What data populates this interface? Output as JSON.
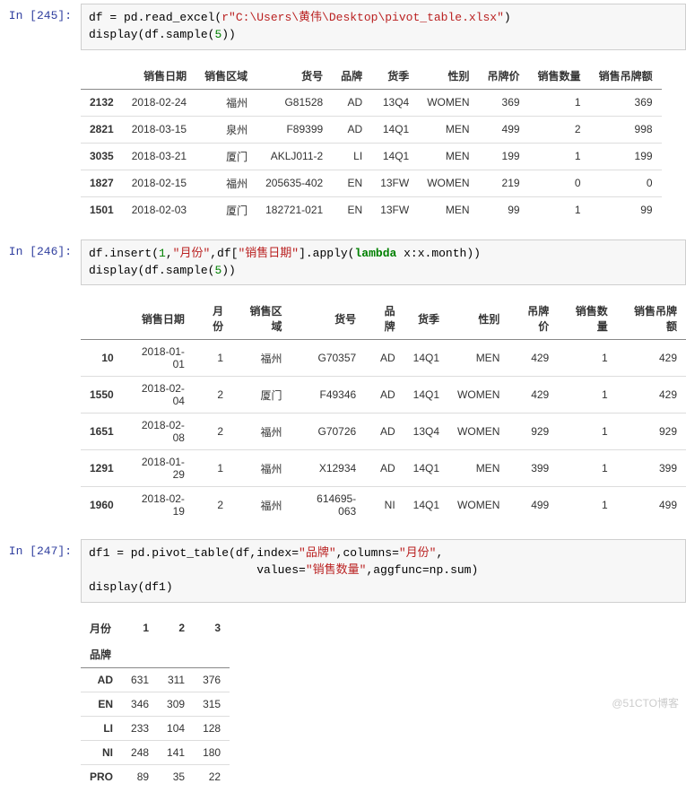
{
  "cells": {
    "c245": {
      "prompt": "In [245]:",
      "code": {
        "l1a": "df = pd.read_excel(",
        "l1b": "r\"C:\\Users\\黄伟\\Desktop\\pivot_table.xlsx\"",
        "l1c": ")",
        "l2a": "display(df.sample(",
        "l2b": "5",
        "l2c": "))"
      }
    },
    "c246": {
      "prompt": "In [246]:",
      "code": {
        "l1a": "df.insert(",
        "l1b": "1",
        "l1c": ",",
        "l1d": "\"月份\"",
        "l1e": ",df[",
        "l1f": "\"销售日期\"",
        "l1g": "].apply(",
        "l1h": "lambda",
        "l1i": " x:x.month))",
        "l2a": "display(df.sample(",
        "l2b": "5",
        "l2c": "))"
      }
    },
    "c247": {
      "prompt": "In [247]:",
      "code": {
        "l1a": "df1 = pd.pivot_table(df,index=",
        "l1b": "\"品牌\"",
        "l1c": ",columns=",
        "l1d": "\"月份\"",
        "l1e": ",",
        "l2pad": "                        ",
        "l2a": "values=",
        "l2b": "\"销售数量\"",
        "l2c": ",aggfunc=np.sum)",
        "l3": "display(df1)"
      }
    }
  },
  "table1": {
    "headers": [
      "",
      "销售日期",
      "销售区域",
      "货号",
      "品牌",
      "货季",
      "性别",
      "吊牌价",
      "销售数量",
      "销售吊牌额"
    ],
    "rows": [
      {
        "idx": "2132",
        "c0": "2018-02-24",
        "c1": "福州",
        "c2": "G81528",
        "c3": "AD",
        "c4": "13Q4",
        "c5": "WOMEN",
        "c6": "369",
        "c7": "1",
        "c8": "369"
      },
      {
        "idx": "2821",
        "c0": "2018-03-15",
        "c1": "泉州",
        "c2": "F89399",
        "c3": "AD",
        "c4": "14Q1",
        "c5": "MEN",
        "c6": "499",
        "c7": "2",
        "c8": "998"
      },
      {
        "idx": "3035",
        "c0": "2018-03-21",
        "c1": "厦门",
        "c2": "AKLJ011-2",
        "c3": "LI",
        "c4": "14Q1",
        "c5": "MEN",
        "c6": "199",
        "c7": "1",
        "c8": "199"
      },
      {
        "idx": "1827",
        "c0": "2018-02-15",
        "c1": "福州",
        "c2": "205635-402",
        "c3": "EN",
        "c4": "13FW",
        "c5": "WOMEN",
        "c6": "219",
        "c7": "0",
        "c8": "0"
      },
      {
        "idx": "1501",
        "c0": "2018-02-03",
        "c1": "厦门",
        "c2": "182721-021",
        "c3": "EN",
        "c4": "13FW",
        "c5": "MEN",
        "c6": "99",
        "c7": "1",
        "c8": "99"
      }
    ]
  },
  "table2": {
    "headers": [
      "",
      "销售日期",
      "月份",
      "销售区域",
      "货号",
      "品牌",
      "货季",
      "性别",
      "吊牌价",
      "销售数量",
      "销售吊牌额"
    ],
    "rows": [
      {
        "idx": "10",
        "c0": "2018-01-01",
        "c1": "1",
        "c2": "福州",
        "c3": "G70357",
        "c4": "AD",
        "c5": "14Q1",
        "c6": "MEN",
        "c7": "429",
        "c8": "1",
        "c9": "429"
      },
      {
        "idx": "1550",
        "c0": "2018-02-04",
        "c1": "2",
        "c2": "厦门",
        "c3": "F49346",
        "c4": "AD",
        "c5": "14Q1",
        "c6": "WOMEN",
        "c7": "429",
        "c8": "1",
        "c9": "429"
      },
      {
        "idx": "1651",
        "c0": "2018-02-08",
        "c1": "2",
        "c2": "福州",
        "c3": "G70726",
        "c4": "AD",
        "c5": "13Q4",
        "c6": "WOMEN",
        "c7": "929",
        "c8": "1",
        "c9": "929"
      },
      {
        "idx": "1291",
        "c0": "2018-01-29",
        "c1": "1",
        "c2": "福州",
        "c3": "X12934",
        "c4": "AD",
        "c5": "14Q1",
        "c6": "MEN",
        "c7": "399",
        "c8": "1",
        "c9": "399"
      },
      {
        "idx": "1960",
        "c0": "2018-02-19",
        "c1": "2",
        "c2": "福州",
        "c3": "614695-063",
        "c4": "NI",
        "c5": "14Q1",
        "c6": "WOMEN",
        "c7": "499",
        "c8": "1",
        "c9": "499"
      }
    ]
  },
  "table3": {
    "col_name": "月份",
    "row_name": "品牌",
    "cols": [
      "1",
      "2",
      "3"
    ],
    "rows": [
      {
        "idx": "AD",
        "c0": "631",
        "c1": "311",
        "c2": "376"
      },
      {
        "idx": "EN",
        "c0": "346",
        "c1": "309",
        "c2": "315"
      },
      {
        "idx": "LI",
        "c0": "233",
        "c1": "104",
        "c2": "128"
      },
      {
        "idx": "NI",
        "c0": "248",
        "c1": "141",
        "c2": "180"
      },
      {
        "idx": "PRO",
        "c0": "89",
        "c1": "35",
        "c2": "22"
      }
    ]
  },
  "watermark": "@51CTO博客"
}
